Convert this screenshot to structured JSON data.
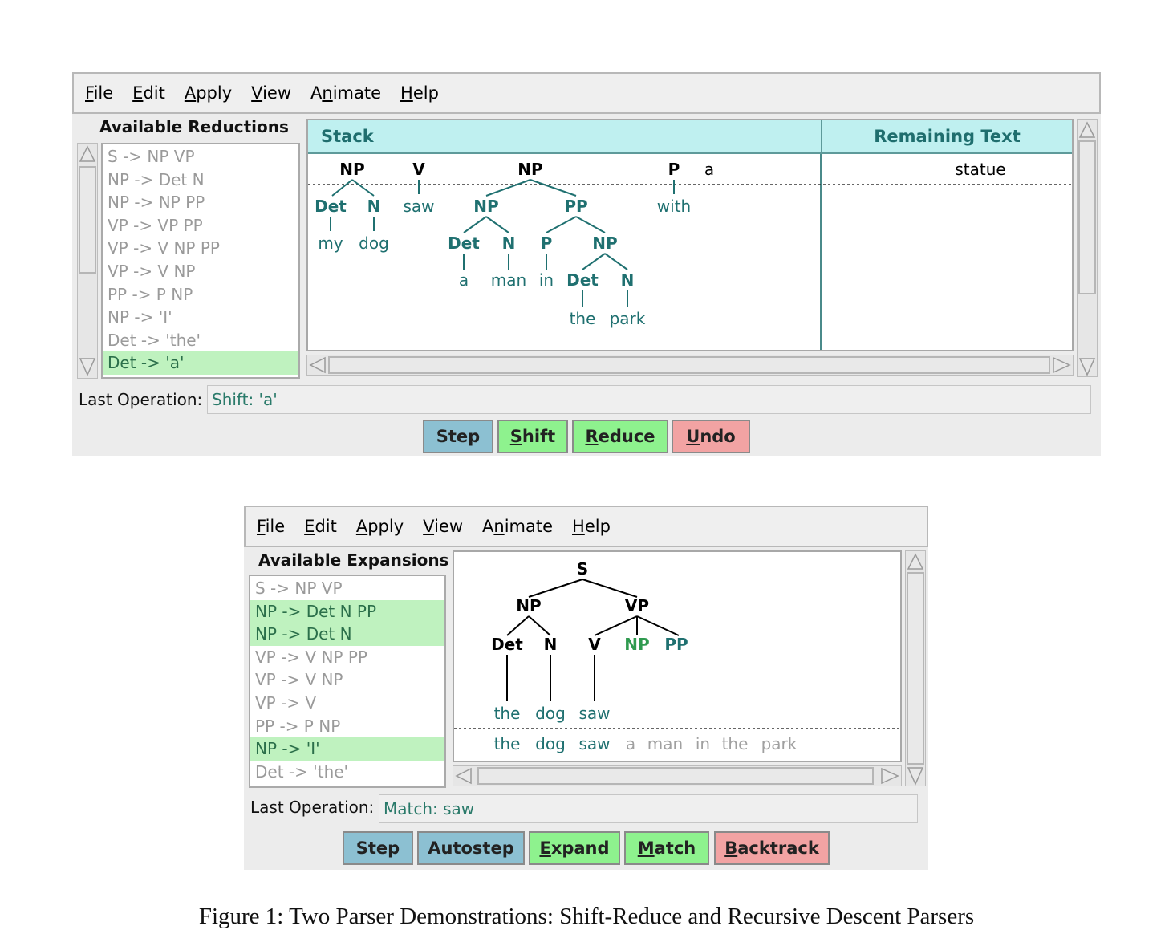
{
  "top": {
    "menu": [
      "File",
      "Edit",
      "Apply",
      "View",
      "Animate",
      "Help"
    ],
    "list_title": "Available Reductions",
    "reductions": [
      {
        "label": "S -> NP VP",
        "hl": false
      },
      {
        "label": "NP -> Det N",
        "hl": false
      },
      {
        "label": "NP -> NP PP",
        "hl": false
      },
      {
        "label": "VP -> VP PP",
        "hl": false
      },
      {
        "label": "VP -> V NP PP",
        "hl": false
      },
      {
        "label": "VP -> V NP",
        "hl": false
      },
      {
        "label": "PP -> P NP",
        "hl": false
      },
      {
        "label": "NP -> 'I'",
        "hl": false
      },
      {
        "label": "Det -> 'the'",
        "hl": false
      },
      {
        "label": "Det -> 'a'",
        "hl": true
      }
    ],
    "stack_header": "Stack",
    "remaining_header": "Remaining Text",
    "remaining_words": [
      "statue"
    ],
    "stack_loose_word": "a",
    "last_op_label": "Last Operation:",
    "last_op_value": "Shift: 'a'",
    "buttons": [
      {
        "label": "Step",
        "color": "blue",
        "underline": ""
      },
      {
        "label": "Shift",
        "color": "green",
        "underline": "S"
      },
      {
        "label": "Reduce",
        "color": "green",
        "underline": "R"
      },
      {
        "label": "Undo",
        "color": "red",
        "underline": "U"
      }
    ]
  },
  "bottom": {
    "menu": [
      "File",
      "Edit",
      "Apply",
      "View",
      "Animate",
      "Help"
    ],
    "list_title": "Available Expansions",
    "expansions": [
      {
        "label": "S -> NP VP",
        "hl": false
      },
      {
        "label": "NP -> Det N PP",
        "hl": true
      },
      {
        "label": "NP -> Det N",
        "hl": true
      },
      {
        "label": "VP -> V NP PP",
        "hl": false
      },
      {
        "label": "VP -> V NP",
        "hl": false
      },
      {
        "label": "VP -> V",
        "hl": false
      },
      {
        "label": "PP -> P NP",
        "hl": false
      },
      {
        "label": "NP -> 'I'",
        "hl": true
      },
      {
        "label": "Det -> 'the'",
        "hl": false
      }
    ],
    "sentence": [
      "the",
      "dog",
      "saw",
      "a",
      "man",
      "in",
      "the",
      "park"
    ],
    "matched_count": 3,
    "last_op_label": "Last Operation:",
    "last_op_value": "Match: saw",
    "buttons": [
      {
        "label": "Step",
        "color": "blue",
        "underline": ""
      },
      {
        "label": "Autostep",
        "color": "blue",
        "underline": ""
      },
      {
        "label": "Expand",
        "color": "green",
        "underline": "E"
      },
      {
        "label": "Match",
        "color": "green",
        "underline": "M"
      },
      {
        "label": "Backtrack",
        "color": "red",
        "underline": "B"
      }
    ]
  },
  "tree_labels": {
    "S": "S",
    "NP": "NP",
    "VP": "VP",
    "PP": "PP",
    "Det": "Det",
    "N": "N",
    "V": "V",
    "P": "P",
    "my": "my",
    "dog": "dog",
    "saw": "saw",
    "a": "a",
    "man": "man",
    "in": "in",
    "the": "the",
    "park": "park",
    "with": "with"
  },
  "caption": "Figure 1: Two Parser Demonstrations: Shift-Reduce and Recursive Descent Parsers",
  "colors": {
    "teal": "#1f7070",
    "green_text": "#2f9a4f",
    "grey_text": "#a0a0a0",
    "highlight": "#bff2bf",
    "header_bg": "#bff0f0"
  }
}
